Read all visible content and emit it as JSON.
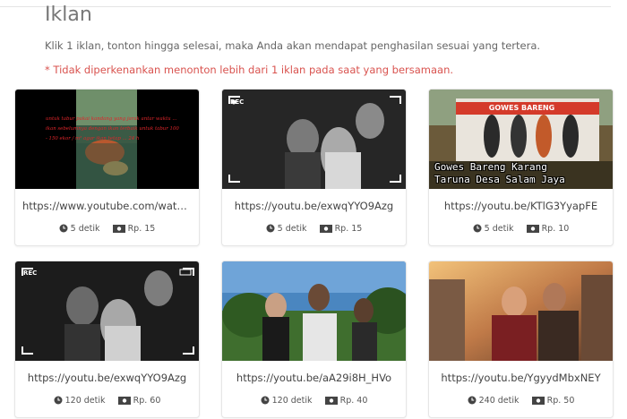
{
  "page": {
    "title": "Iklan",
    "description": "Klik 1 iklan, tonton hingga selesai, maka Anda akan mendapat penghasilan sesuai yang tertera.",
    "warning": "* Tidak diperkenankan menonton lebih dari 1 iklan pada saat yang bersamaan."
  },
  "ads": [
    {
      "url": "https://www.youtube.com/watch?v=...",
      "duration": "5 detik",
      "reward": "Rp. 15",
      "thumb_text": "untuk tabur pakai kandang yang jarak antar waktu ... ikan sebelumnya dengan ikan terbaik untuk tabur 100 - 150 ekor / m² agar ikan tetap ... 24 h"
    },
    {
      "url": "https://youtu.be/exwqYYO9Azg",
      "duration": "5 detik",
      "reward": "Rp. 15",
      "thumb_badge": "REC"
    },
    {
      "url": "https://youtu.be/KTlG3YyapFE",
      "duration": "5 detik",
      "reward": "Rp. 10",
      "thumb_banner": "GOWES BARENG",
      "thumb_caption_1": "Gowes Bareng Karang",
      "thumb_caption_2": "Taruna Desa Salam Jaya"
    },
    {
      "url": "https://youtu.be/exwqYYO9Azg",
      "duration": "120 detik",
      "reward": "Rp. 60",
      "thumb_badge": "REC"
    },
    {
      "url": "https://youtu.be/aA29i8H_HVo",
      "duration": "120 detik",
      "reward": "Rp. 40"
    },
    {
      "url": "https://youtu.be/YgyydMbxNEY",
      "duration": "240 detik",
      "reward": "Rp. 50"
    }
  ],
  "colors": {
    "warning": "#d9534f",
    "title": "#777777"
  },
  "icons": {
    "duration": "clock-icon",
    "reward": "money-icon"
  }
}
